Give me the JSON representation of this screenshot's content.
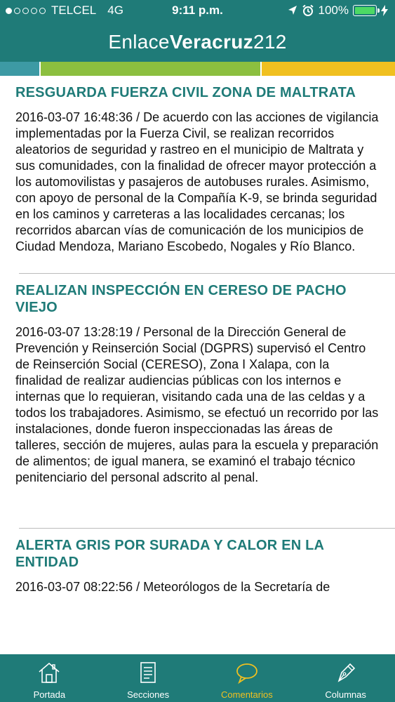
{
  "status_bar": {
    "carrier": "TELCEL",
    "network": "4G",
    "time": "9:11 p.m.",
    "battery": "100%"
  },
  "header": {
    "title_part1": "Enlace",
    "title_part2": "Veracruz",
    "title_part3": "212"
  },
  "colors": {
    "primary": "#1f7b78",
    "stripe_blue": "#3d9aa4",
    "stripe_green": "#8cbf3f",
    "stripe_yellow": "#f0c020",
    "active_tab": "#f0c020"
  },
  "articles": [
    {
      "title": "RESGUARDA FUERZA CIVIL ZONA DE MALTRATA",
      "body": "2016-03-07 16:48:36 / De acuerdo con las acciones de vigilancia implementadas por la Fuerza Civil, se realizan recorridos aleatorios de seguridad y rastreo en el municipio de Maltrata y sus comunidades, con la finalidad de ofrecer mayor protección a los automovilistas y pasajeros de autobuses rurales. Asimismo, con apoyo de personal de la Compañía K-9, se brinda seguridad en los caminos y carreteras a las localidades cercanas; los recorridos abarcan vías de comunicación de los municipios de Ciudad Mendoza, Mariano Escobedo, Nogales y Río Blanco."
    },
    {
      "title": "REALIZAN INSPECCIÓN EN CERESO DE PACHO VIEJO",
      "body": "2016-03-07 13:28:19 / Personal de la Dirección General de Prevención y Reinserción Social (DGPRS) supervisó el Centro de Reinserción Social (CERESO), Zona I Xalapa, con la finalidad de realizar audiencias públicas con los internos e internas que lo requieran, visitando cada una de las celdas y a todos los trabajadores. Asimismo, se efectuó un recorrido por las instalaciones, donde fueron inspeccionadas las áreas de talleres, sección de mujeres, aulas para la escuela y preparación de alimentos; de igual manera, se examinó el trabajo técnico penitenciario del personal adscrito al penal."
    },
    {
      "title": "ALERTA GRIS POR SURADA Y CALOR EN LA ENTIDAD",
      "body": "2016-03-07 08:22:56 / Meteorólogos de la Secretaría de"
    }
  ],
  "tabs": [
    {
      "label": "Portada",
      "icon": "house-icon"
    },
    {
      "label": "Secciones",
      "icon": "document-icon"
    },
    {
      "label": "Comentarios",
      "icon": "speech-bubble-icon"
    },
    {
      "label": "Columnas",
      "icon": "fountain-pen-icon"
    }
  ]
}
